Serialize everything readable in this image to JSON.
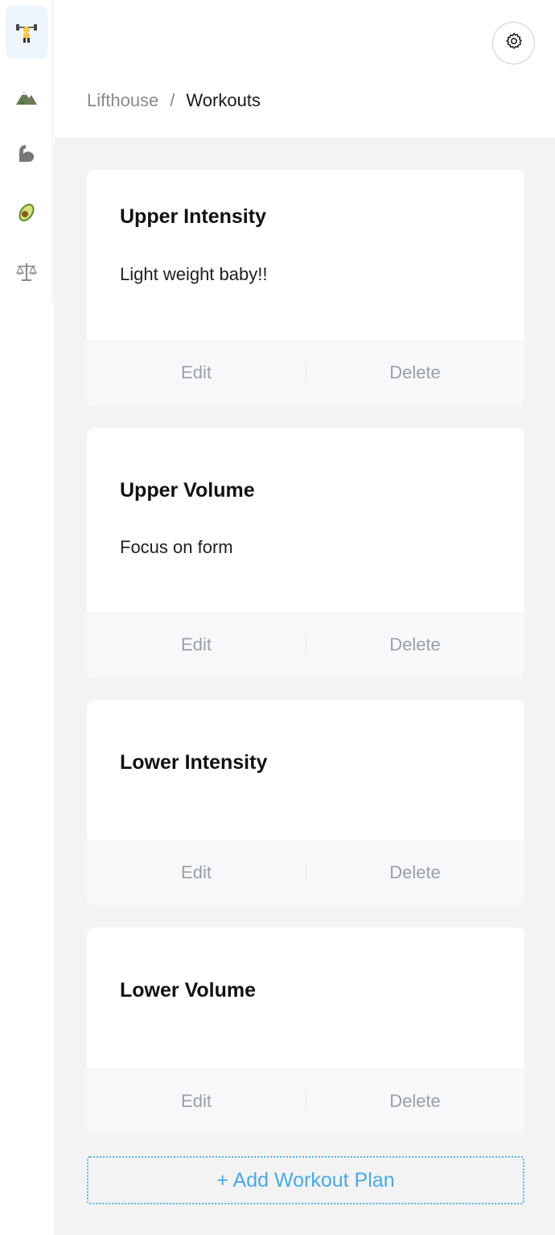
{
  "sidebar": {
    "items": [
      {
        "name": "weightlifter-icon",
        "active": true
      },
      {
        "name": "mountain-icon",
        "active": false
      },
      {
        "name": "flexed-biceps-icon",
        "active": false
      },
      {
        "name": "avocado-icon",
        "active": false
      },
      {
        "name": "scale-icon",
        "active": false
      }
    ]
  },
  "header": {
    "settings_icon": "gear-icon",
    "breadcrumb": {
      "root": "Lifthouse",
      "separator": "/",
      "current": "Workouts"
    }
  },
  "workouts": [
    {
      "title": "Upper Intensity",
      "description": "Light weight baby!!",
      "edit_label": "Edit",
      "delete_label": "Delete"
    },
    {
      "title": "Upper Volume",
      "description": "Focus on form",
      "edit_label": "Edit",
      "delete_label": "Delete"
    },
    {
      "title": "Lower Intensity",
      "description": "",
      "edit_label": "Edit",
      "delete_label": "Delete"
    },
    {
      "title": "Lower Volume",
      "description": "",
      "edit_label": "Edit",
      "delete_label": "Delete"
    }
  ],
  "add_button_label": "+ Add Workout Plan",
  "colors": {
    "accent": "#4aa8e6",
    "active_nav_bg": "#eef5fc",
    "muted_text": "#9aa0a6"
  }
}
